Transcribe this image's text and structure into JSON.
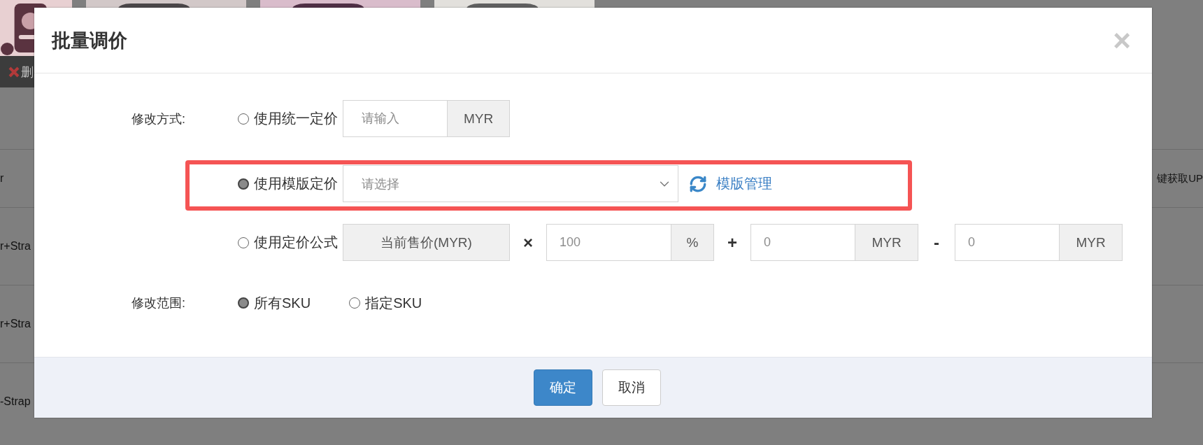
{
  "background": {
    "delete_label": "删",
    "rows": [
      {
        "column_1": "r",
        "column_last": "键获取UP"
      },
      {
        "column_1": "r+Stra"
      },
      {
        "column_1": "r+Stra"
      },
      {
        "column_1": "-Strap"
      }
    ]
  },
  "dialog": {
    "title": "批量调价",
    "close": "×",
    "method_label": "修改方式:",
    "methods": [
      {
        "kind": "fixed",
        "label": "使用统一定价",
        "selected": false,
        "placeholder": "请输入",
        "suffix": "MYR"
      },
      {
        "kind": "template",
        "label": "使用模版定价",
        "selected": true,
        "highlighted": true,
        "placeholder": "请选择",
        "link": "模版管理"
      },
      {
        "kind": "formula",
        "label": "使用定价公式",
        "selected": false,
        "parts": [
          {
            "kind": "addon",
            "text": "当前售价(MYR)"
          },
          {
            "kind": "operator",
            "text": "×"
          },
          {
            "kind": "input",
            "placeholder": "100",
            "suffix": "%"
          },
          {
            "kind": "operator",
            "text": "+"
          },
          {
            "kind": "input",
            "placeholder": "0",
            "suffix": "MYR"
          },
          {
            "kind": "operator",
            "text": "-"
          },
          {
            "kind": "input",
            "placeholder": "0",
            "suffix": "MYR"
          }
        ]
      }
    ],
    "scope_label": "修改范围:",
    "scopes": [
      {
        "label": "所有SKU",
        "selected": true
      },
      {
        "label": "指定SKU",
        "selected": false
      }
    ],
    "buttons": [
      {
        "kind": "primary",
        "label": "确定"
      },
      {
        "kind": "default",
        "label": "取消"
      }
    ]
  }
}
